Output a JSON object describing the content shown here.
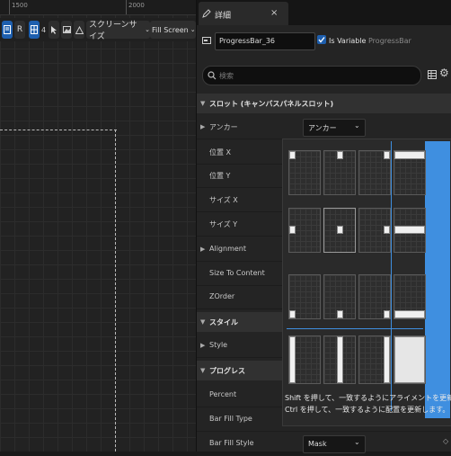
{
  "ruler": {
    "labels": [
      "1500",
      "2000"
    ]
  },
  "toolbar": {
    "r_label": "R",
    "grid_count": "4",
    "screen_size_label": "スクリーンサイズ",
    "fill_screen_label": "Fill Screen"
  },
  "details": {
    "tab_label": "詳細",
    "close_label": "×",
    "widget_name": "ProgressBar_36",
    "is_variable_label": "Is Variable",
    "widget_type": "ProgressBar",
    "search_placeholder": "検索",
    "sections": {
      "slot": "スロット (キャンバスパネルスロット)",
      "style": "スタイル",
      "progress": "プログレス"
    },
    "props": {
      "anchor": "アンカー",
      "anchor_value": "アンカー",
      "pos_x": "位置 X",
      "pos_y": "位置 Y",
      "size_x": "サイズ X",
      "size_y": "サイズ Y",
      "alignment": "Alignment",
      "size_to_content": "Size To Content",
      "zorder": "ZOrder",
      "style": "Style",
      "percent": "Percent",
      "bar_fill_type": "Bar Fill Type",
      "bar_fill_style": "Bar Fill Style",
      "bar_fill_style_value": "Mask"
    }
  },
  "anchor_popup": {
    "hint_line1": "Shift を押して、一致するようにアライメントを更新します。",
    "hint_line2": "Ctrl を押して、一致するように配置を更新します。"
  },
  "colors": {
    "accent": "#1e5fae",
    "stretch_bar": "#3f8fe0"
  }
}
